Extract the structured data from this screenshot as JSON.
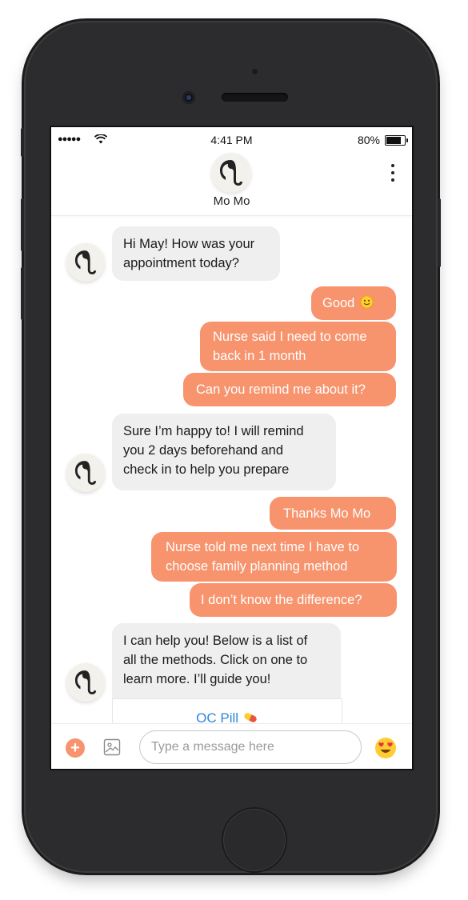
{
  "status_bar": {
    "signal": "●●●●●",
    "time": "4:41 PM",
    "battery": "80%"
  },
  "header": {
    "contact_name": "Mo Mo",
    "avatar_icon": "elephant-icon",
    "menu_icon": "more-vertical-icon"
  },
  "messages": [
    {
      "from": "bot",
      "lines": [
        "Hi May! How was your",
        "appointment today?"
      ]
    },
    {
      "from": "user",
      "text": "Good",
      "emoji": "slightly-smiling-face"
    },
    {
      "from": "user",
      "lines": [
        "Nurse said I need to come",
        "back in 1 month"
      ]
    },
    {
      "from": "user",
      "text": "Can you remind me about it?"
    },
    {
      "from": "bot",
      "lines": [
        "Sure I’m happy to! I will remind",
        "you 2 days beforehand and",
        "check in to help you prepare"
      ]
    },
    {
      "from": "user",
      "text": "Thanks Mo Mo"
    },
    {
      "from": "user",
      "lines": [
        "Nurse told me next time I have to",
        "choose family planning method"
      ]
    },
    {
      "from": "user",
      "text": "I don’t know the difference?"
    },
    {
      "from": "bot",
      "lines": [
        "I can help you! Below is a list of",
        "all the methods. Click on one to",
        "learn more. I’ll guide you!"
      ]
    }
  ],
  "option_card": {
    "label": "OC Pill",
    "icon": "pill-icon"
  },
  "composer": {
    "placeholder": "Type a message here",
    "value": "",
    "add_icon": "plus-icon",
    "image_icon": "image-icon",
    "emoji_icon": "heart-eyes-emoji-icon"
  },
  "colors": {
    "accent": "#f7936d",
    "incoming_bubble": "#efefef",
    "link": "#2f86d6",
    "device": "#2c2c2e"
  }
}
